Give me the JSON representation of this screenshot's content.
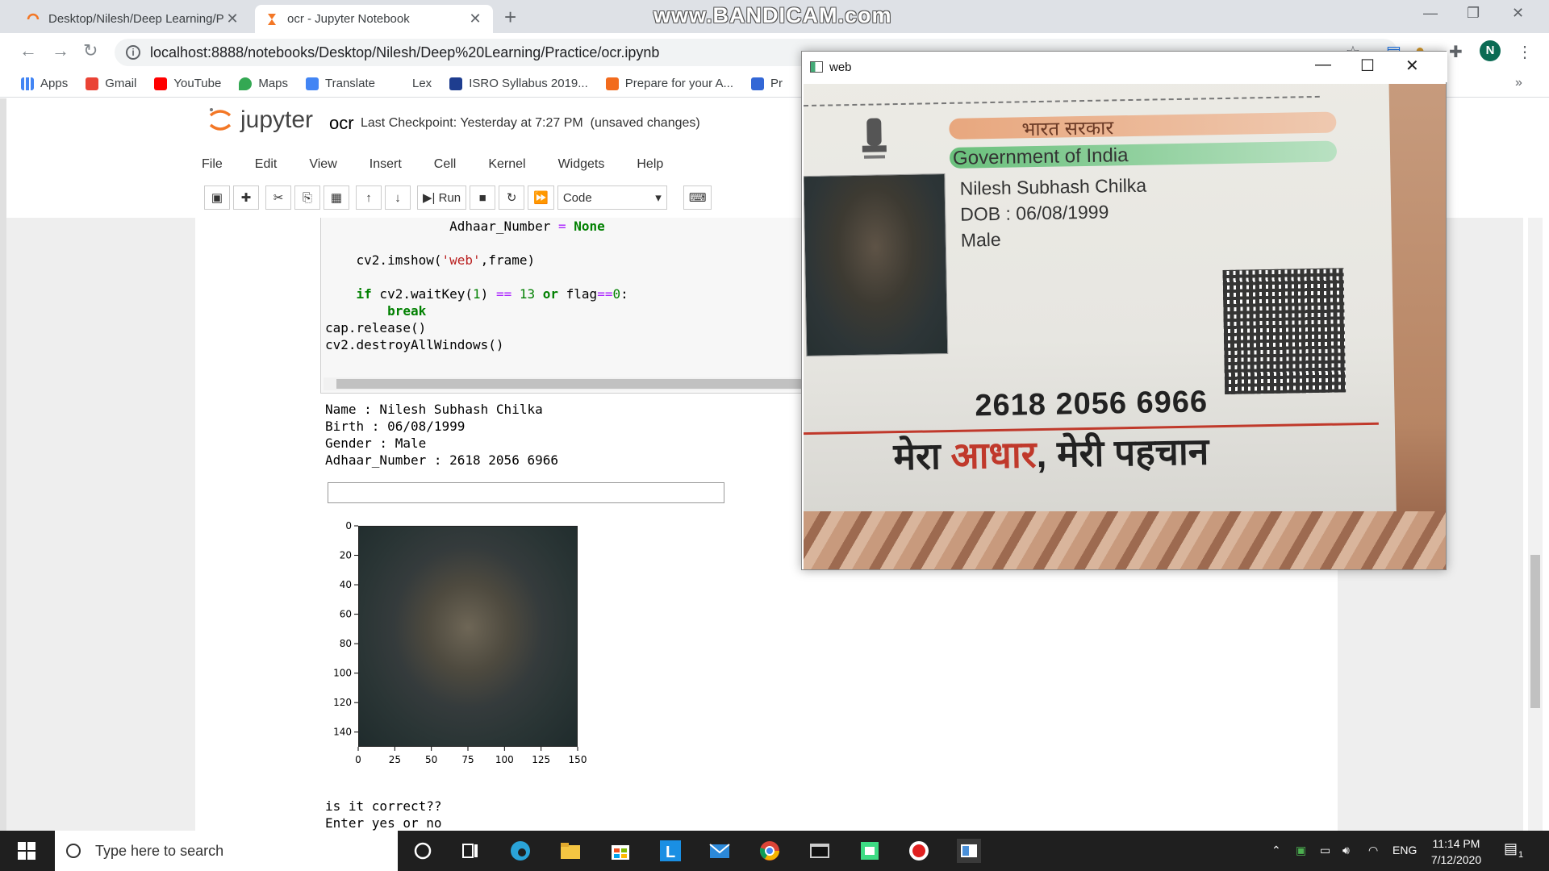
{
  "browser": {
    "tabs": [
      {
        "title": "Desktop/Nilesh/Deep Learning/P",
        "active": false
      },
      {
        "title": "ocr - Jupyter Notebook",
        "active": true
      }
    ],
    "url": "localhost:8888/notebooks/Desktop/Nilesh/Deep%20Learning/Practice/ocr.ipynb",
    "watermark": "www.BANDICAM.com",
    "profile_initial": "N",
    "bookmarks": [
      "Apps",
      "Gmail",
      "YouTube",
      "Maps",
      "Translate",
      "Lex",
      "ISRO Syllabus 2019...",
      "Prepare for your A...",
      "Pr"
    ]
  },
  "notebook": {
    "logo_text": "jupyter",
    "name": "ocr",
    "checkpoint": "Last Checkpoint: Yesterday at 7:27 PM",
    "unsaved": "(unsaved changes)",
    "menu": [
      "File",
      "Edit",
      "View",
      "Insert",
      "Cell",
      "Kernel",
      "Widgets",
      "Help"
    ],
    "toolbar": {
      "run_label": "Run",
      "cell_type": "Code"
    },
    "code_lines": [
      "                Adhaar_Number = None",
      "",
      "    cv2.imshow('web',frame)",
      "",
      "    if cv2.waitKey(1) == 13 or flag==0:",
      "        break",
      "cap.release()",
      "cv2.destroyAllWindows()"
    ],
    "output_lines": [
      "Name : Nilesh Subhash Chilka",
      "Birth : 06/08/1999",
      "Gender : Male",
      "Adhaar_Number : 2618 2056 6966"
    ],
    "prompt_lines": [
      "is it correct??",
      "Enter yes or no"
    ]
  },
  "chart_data": {
    "type": "image",
    "x_ticks": [
      "0",
      "25",
      "50",
      "75",
      "100",
      "125",
      "150"
    ],
    "y_ticks": [
      "0",
      "20",
      "40",
      "60",
      "80",
      "100",
      "120",
      "140"
    ],
    "xlim": [
      0,
      150
    ],
    "ylim": [
      0,
      150
    ]
  },
  "webcam_window": {
    "title": "web",
    "card": {
      "hindi_header": "भारत सरकार",
      "header": "Government of India",
      "name": "Nilesh Subhash Chilka",
      "dob": "DOB : 06/08/1999",
      "gender": "Male",
      "number": "2618  2056  6966",
      "slogan_a": "मेरा ",
      "slogan_b": "आधार",
      "slogan_c": ", मेरी पहचान"
    }
  },
  "taskbar": {
    "search_placeholder": "Type here to search",
    "language": "ENG",
    "time": "11:14 PM",
    "date": "7/12/2020",
    "notifications": "1"
  }
}
